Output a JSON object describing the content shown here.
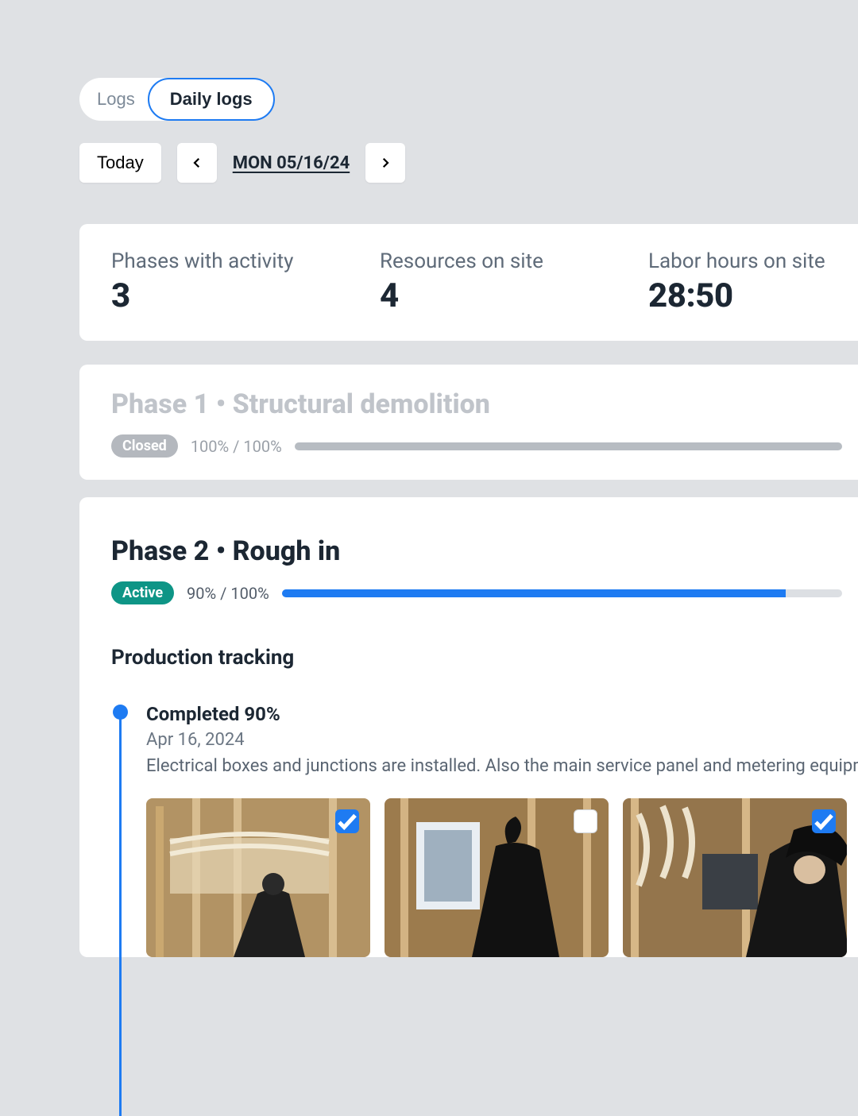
{
  "tabs": {
    "logs": "Logs",
    "daily": "Daily logs"
  },
  "datebar": {
    "today": "Today",
    "date": "MON 05/16/24"
  },
  "stats": [
    {
      "label": "Phases with activity",
      "value": "3"
    },
    {
      "label": "Resources on site",
      "value": "4"
    },
    {
      "label": "Labor hours on site",
      "value": "28:50"
    }
  ],
  "phase1": {
    "title": "Phase 1 • Structural demolition",
    "status": "Closed",
    "pct": "100% / 100%"
  },
  "phase2": {
    "title": "Phase 2 • Rough in",
    "status": "Active",
    "pct": "90% / 100%",
    "section": "Production tracking",
    "entry": {
      "title": "Completed 90%",
      "date": "Apr 16, 2024",
      "desc": "Electrical boxes and junctions are installed. Also the main service panel and metering equipme"
    }
  }
}
